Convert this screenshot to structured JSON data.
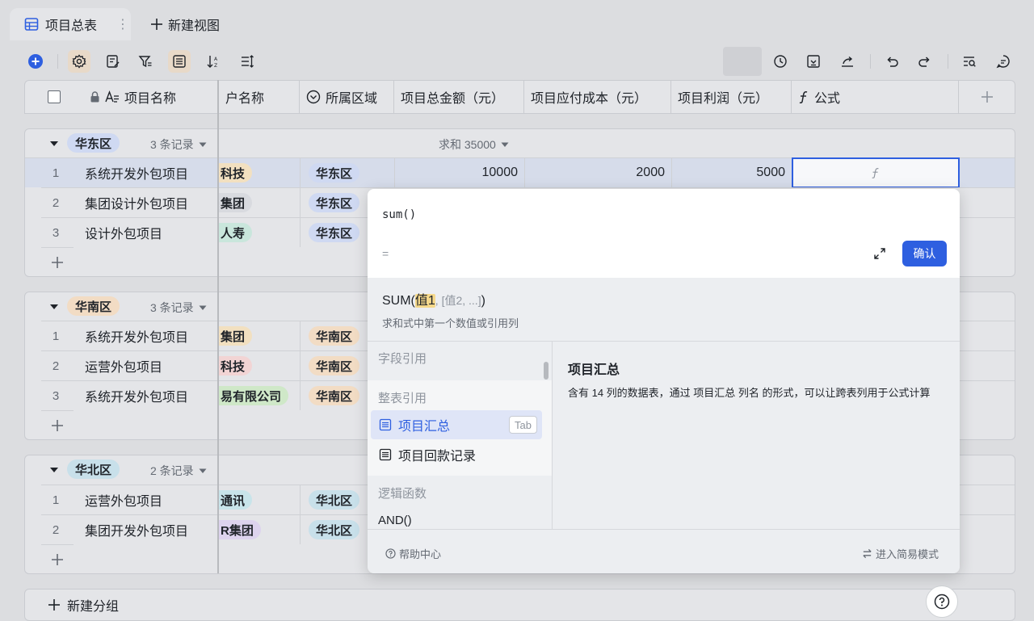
{
  "tabs": {
    "main_label": "项目总表",
    "more": "⋮",
    "new_view": "新建视图"
  },
  "columns": {
    "name": "项目名称",
    "client": "户名称",
    "region": "所属区域",
    "total": "项目总金额（元）",
    "cost": "项目应付成本（元）",
    "profit": "项目利润（元）",
    "formula": "公式"
  },
  "groups": [
    {
      "tag": "华东区",
      "count": "3 条记录",
      "summary": "求和 35000",
      "rows": [
        {
          "num": "1",
          "name": "系统开发外包项目",
          "client": "科技",
          "region": "华东区",
          "total": "10000",
          "cost": "2000",
          "profit": "5000"
        },
        {
          "num": "2",
          "name": "集团设计外包项目",
          "client": "集团",
          "region": "华东区"
        },
        {
          "num": "3",
          "name": "设计外包项目",
          "client": "人寿",
          "region": "华东区"
        }
      ]
    },
    {
      "tag": "华南区",
      "count": "3 条记录",
      "rows": [
        {
          "num": "1",
          "name": "系统开发外包项目",
          "client": "集团",
          "region": "华南区"
        },
        {
          "num": "2",
          "name": "运营外包项目",
          "client": "科技",
          "region": "华南区"
        },
        {
          "num": "3",
          "name": "系统开发外包项目",
          "client": "易有限公司",
          "region": "华南区"
        }
      ]
    },
    {
      "tag": "华北区",
      "count": "2 条记录",
      "rows": [
        {
          "num": "1",
          "name": "运营外包项目",
          "client": "通讯",
          "region": "华北区"
        },
        {
          "num": "2",
          "name": "集团开发外包项目",
          "client": "R集团",
          "region": "华北区"
        }
      ]
    }
  ],
  "new_group": "新建分组",
  "formula_panel": {
    "input": "sum()",
    "equals": "=",
    "confirm": "确认",
    "signature_fn": "SUM(",
    "signature_hl": "值1",
    "signature_opt": ", [值2, ...]",
    "signature_end": ")",
    "description": "求和式中第一个数值或引用列",
    "sections": {
      "field_ref": "字段引用",
      "table_ref": "整表引用",
      "logic": "逻辑函数"
    },
    "items": {
      "table1": "项目汇总",
      "table2": "项目回款记录",
      "tab_key": "Tab",
      "and_fn": "AND()"
    },
    "detail_title": "项目汇总",
    "detail_body": "含有 14 列的数据表，通过 项目汇总 列名 的形式，可以让跨表列用于公式计算",
    "help": "帮助中心",
    "simple_mode": "进入简易模式"
  },
  "colors": {
    "accent": "#2e5fe0",
    "tag_east": "#cfd9f2",
    "tag_south": "#f2dcc4",
    "tag_north": "#c8e0ea"
  }
}
